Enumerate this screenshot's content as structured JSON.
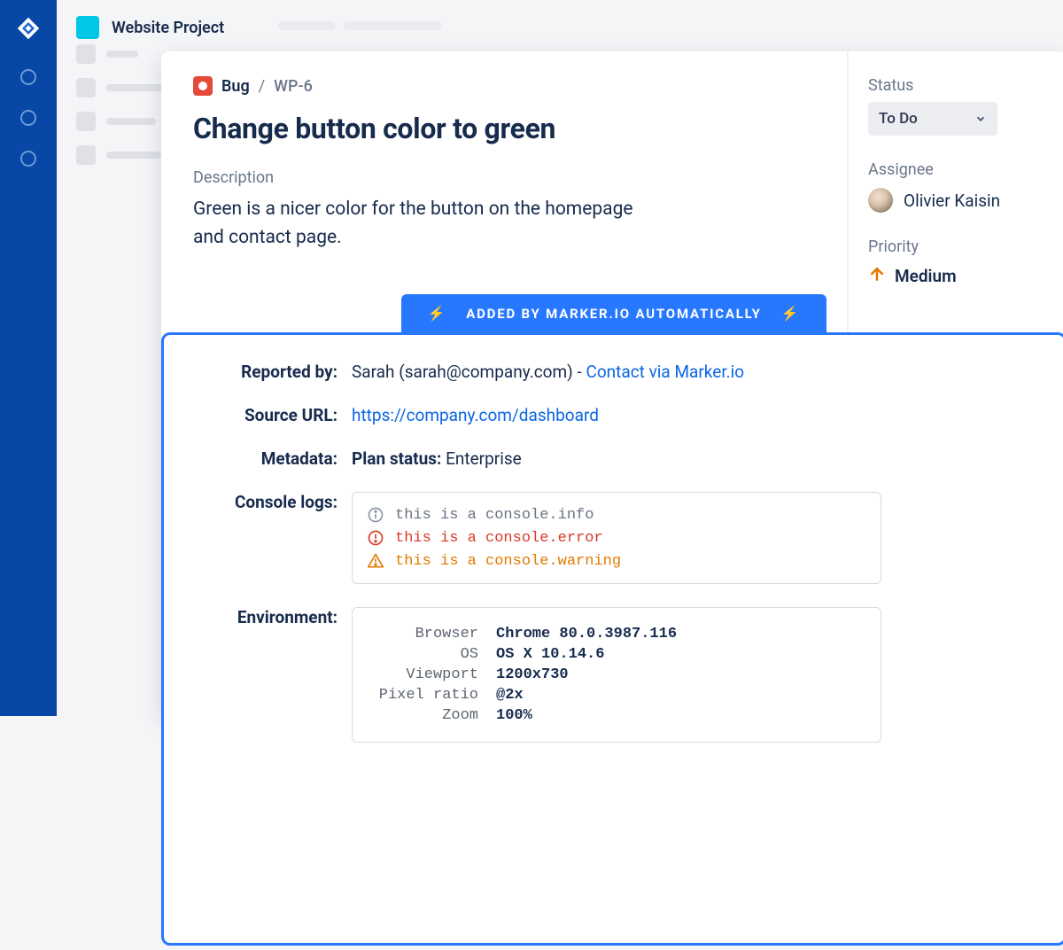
{
  "project": {
    "name": "Website Project"
  },
  "issue": {
    "type": "Bug",
    "key": "WP-6",
    "title": "Change button color to green",
    "description_label": "Description",
    "description": "Green is a nicer color for the button on the homepage and contact page."
  },
  "side": {
    "status_label": "Status",
    "status_value": "To Do",
    "assignee_label": "Assignee",
    "assignee_name": "Olivier Kaisin",
    "priority_label": "Priority",
    "priority_value": "Medium"
  },
  "banner": {
    "text": "ADDED BY MARKER.IO AUTOMATICALLY"
  },
  "details": {
    "reported_by_label": "Reported by:",
    "reported_by_text": "Sarah (sarah@company.com) - ",
    "reported_by_link": "Contact via Marker.io",
    "source_url_label": "Source URL:",
    "source_url": "https://company.com/dashboard",
    "metadata_label": "Metadata:",
    "metadata_key": "Plan status:",
    "metadata_value": "Enterprise",
    "console_label": "Console logs:",
    "console": {
      "info": "this is a console.info",
      "error": "this is a console.error",
      "warning": "this is a console.warning"
    },
    "env_label": "Environment:",
    "env": {
      "browser_k": "Browser",
      "browser_v": "Chrome 80.0.3987.116",
      "os_k": "OS",
      "os_v": "OS X 10.14.6",
      "viewport_k": "Viewport",
      "viewport_v": "1200x730",
      "pixelratio_k": "Pixel ratio",
      "pixelratio_v": "@2x",
      "zoom_k": "Zoom",
      "zoom_v": "100%"
    }
  }
}
